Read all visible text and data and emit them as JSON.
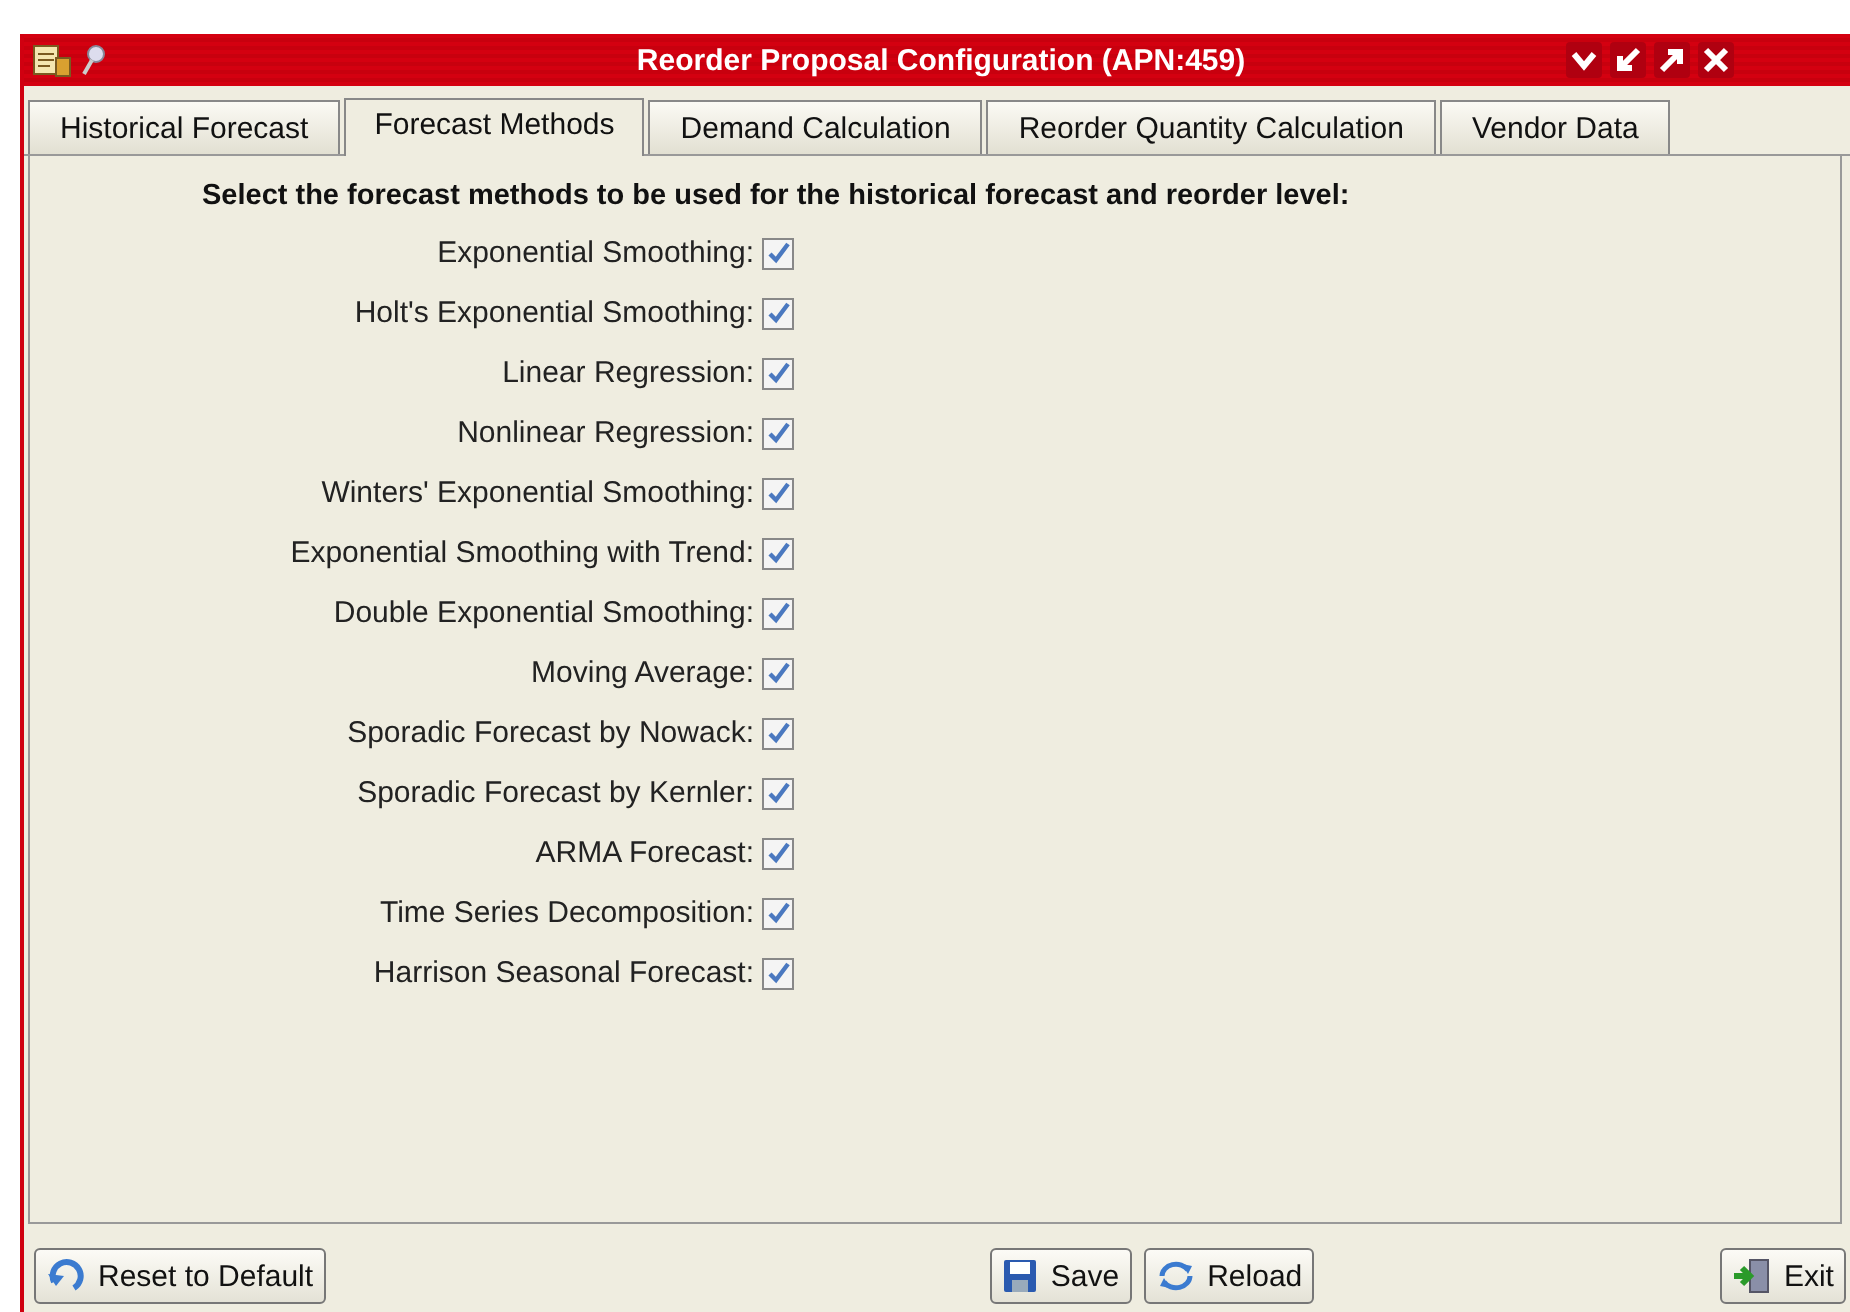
{
  "window": {
    "title": "Reorder Proposal Configuration (APN:459)"
  },
  "tabs": [
    {
      "label": "Historical Forecast",
      "selected": false
    },
    {
      "label": "Forecast Methods",
      "selected": true
    },
    {
      "label": "Demand Calculation",
      "selected": false
    },
    {
      "label": "Reorder Quantity Calculation",
      "selected": false
    },
    {
      "label": "Vendor Data",
      "selected": false
    }
  ],
  "heading": "Select the forecast methods to be used for the historical forecast and reorder level:",
  "methods": [
    {
      "label": "Exponential Smoothing:",
      "checked": true
    },
    {
      "label": "Holt's Exponential Smoothing:",
      "checked": true
    },
    {
      "label": "Linear Regression:",
      "checked": true
    },
    {
      "label": "Nonlinear Regression:",
      "checked": true
    },
    {
      "label": "Winters' Exponential Smoothing:",
      "checked": true
    },
    {
      "label": "Exponential Smoothing with Trend:",
      "checked": true
    },
    {
      "label": "Double Exponential Smoothing:",
      "checked": true
    },
    {
      "label": "Moving Average:",
      "checked": true
    },
    {
      "label": "Sporadic Forecast by Nowack:",
      "checked": true
    },
    {
      "label": "Sporadic Forecast by Kernler:",
      "checked": true
    },
    {
      "label": "ARMA Forecast:",
      "checked": true
    },
    {
      "label": "Time Series Decomposition:",
      "checked": true
    },
    {
      "label": "Harrison Seasonal Forecast:",
      "checked": true
    }
  ],
  "buttons": [
    {
      "label": "Reset to Default",
      "kind": "reset"
    },
    {
      "label": "Save",
      "kind": "save"
    },
    {
      "label": "Reload",
      "kind": "reload"
    },
    {
      "label": "Exit",
      "kind": "exit"
    }
  ]
}
